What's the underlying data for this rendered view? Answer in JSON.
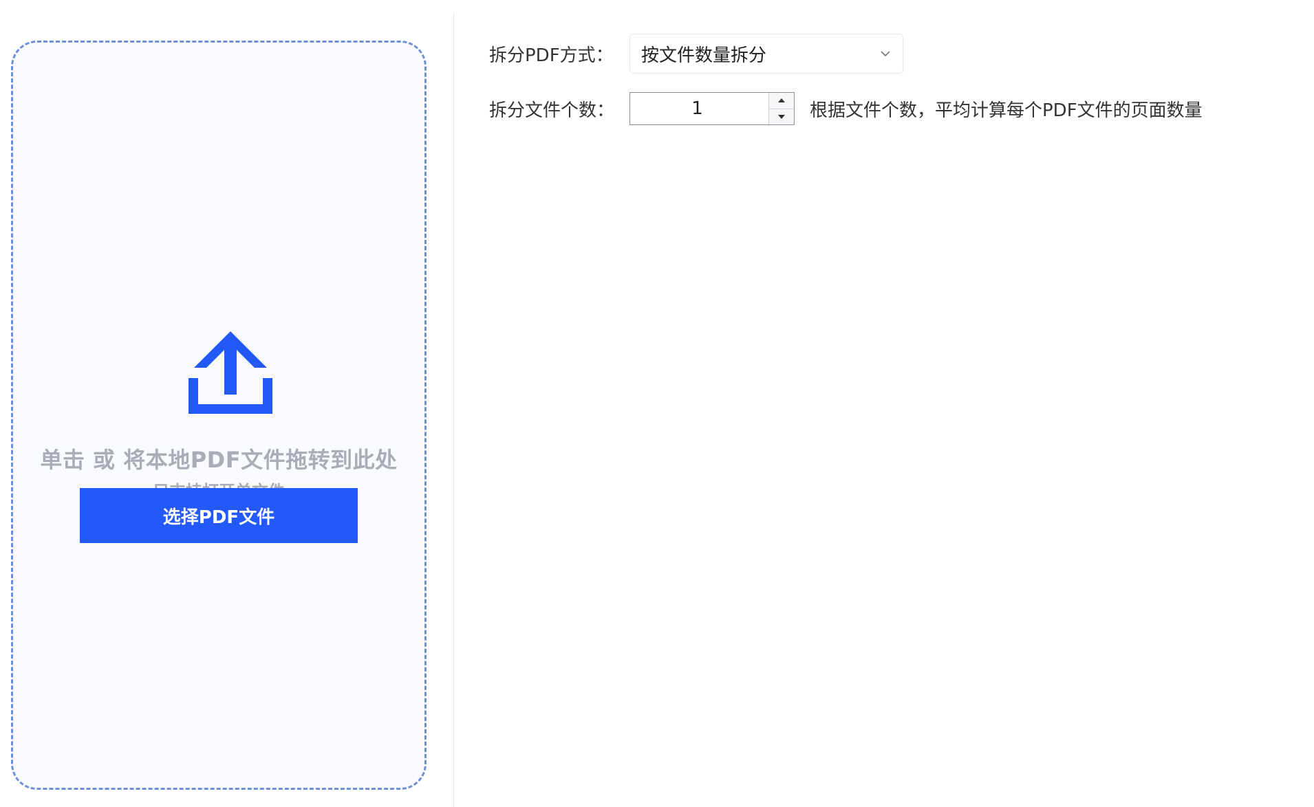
{
  "upload": {
    "hint": "单击 或 将本地PDF文件拖转到此处",
    "subhint": "只支持打开单文件",
    "button_label": "选择PDF文件",
    "icon": "upload-icon"
  },
  "settings": {
    "mode_label": "拆分PDF方式：",
    "mode_value": "按文件数量拆分",
    "count_label": "拆分文件个数：",
    "count_value": "1",
    "count_hint": "根据文件个数，平均计算每个PDF文件的页面数量"
  },
  "colors": {
    "accent": "#2359f8",
    "dropzone_border": "#6e8fd8",
    "dropzone_bg": "#f8fafe",
    "hint_text": "#a9adb6"
  }
}
